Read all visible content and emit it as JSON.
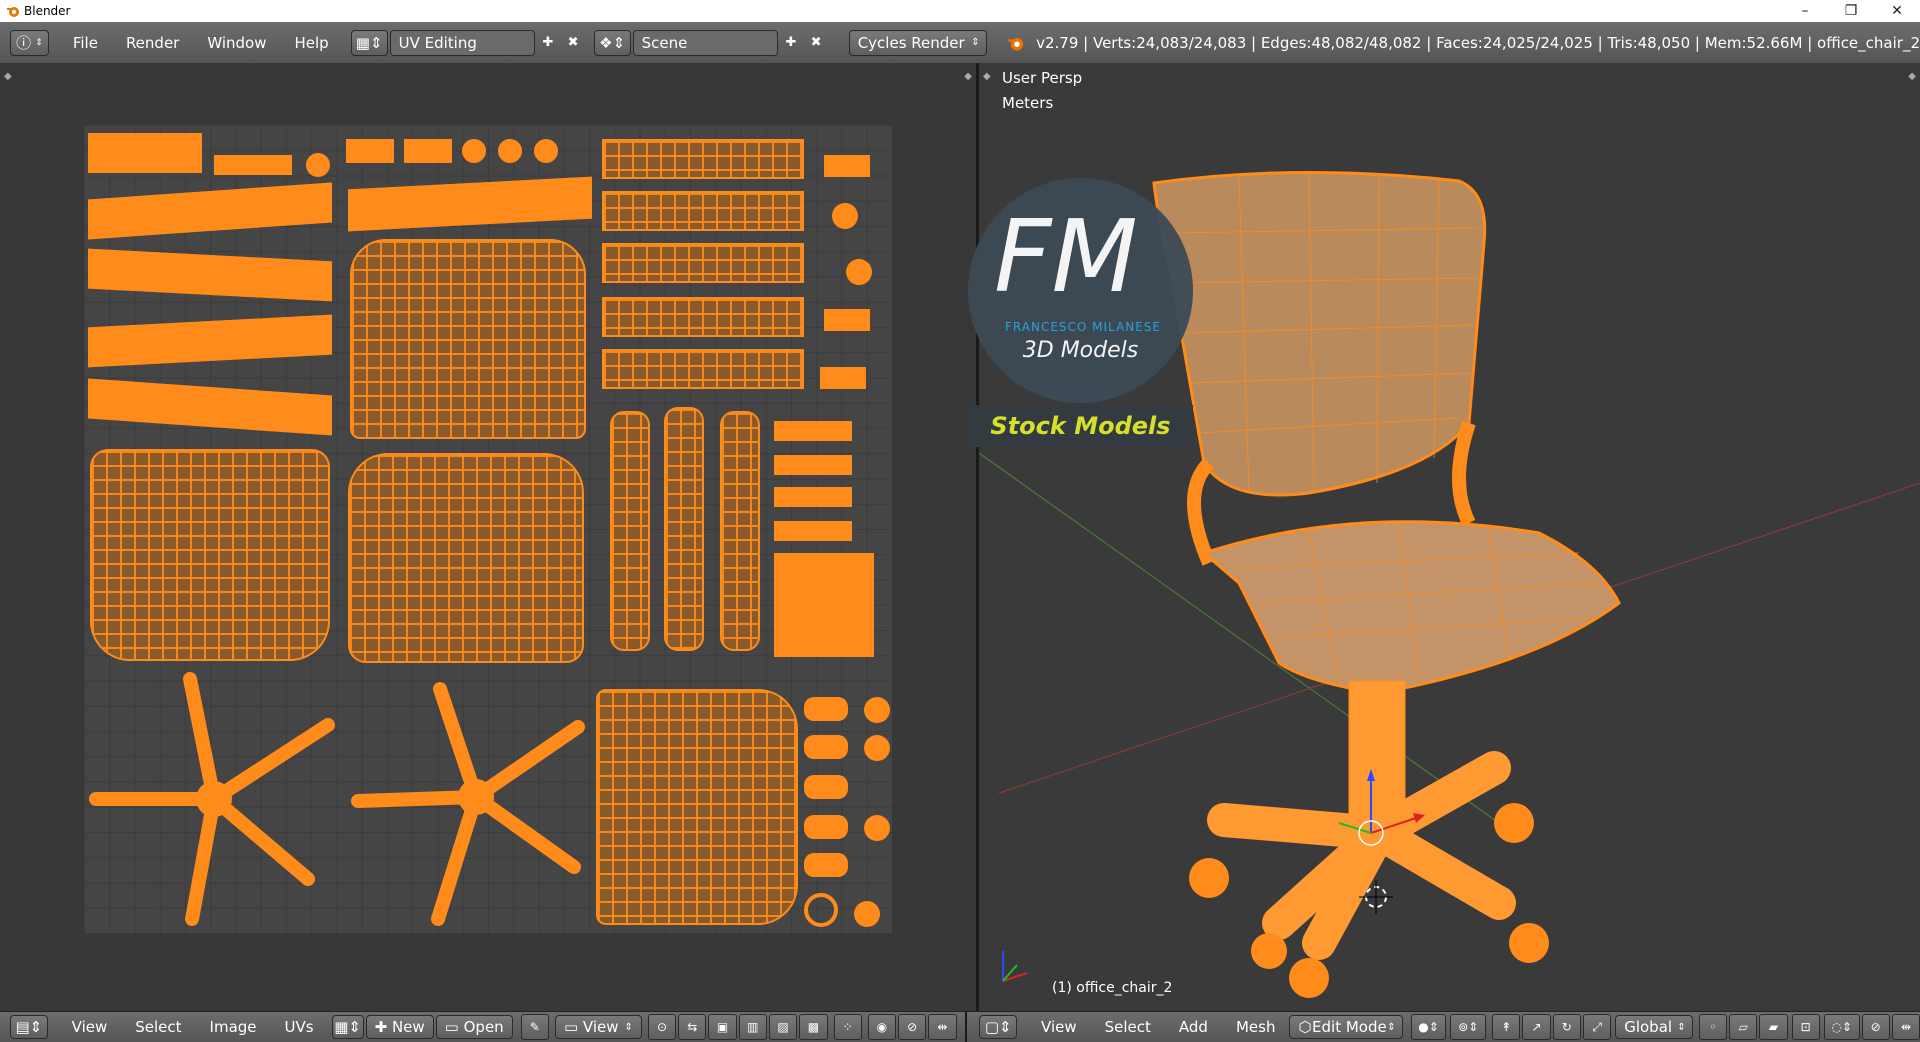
{
  "window": {
    "title": "Blender",
    "controls": [
      "–",
      "❐",
      "✕"
    ]
  },
  "topbar": {
    "menus": [
      "File",
      "Render",
      "Window",
      "Help"
    ],
    "screen_layout": "UV Editing",
    "scene": "Scene",
    "render_engine": "Cycles Render",
    "stats": "v2.79 | Verts:24,083/24,083 | Edges:48,082/48,082 | Faces:24,025/24,025 | Tris:48,050 | Mem:52.66M | office_chair_2"
  },
  "viewport": {
    "view_label": "User Persp",
    "units_label": "Meters",
    "object_label": "(1) office_chair_2",
    "badge": {
      "brand": "FM",
      "author": "FRANCESCO MILANESE",
      "subtitle": "3D Models",
      "banner": "Stock Models"
    }
  },
  "uv_bottombar": {
    "menus": [
      "View",
      "Select",
      "Image",
      "UVs"
    ],
    "new_label": "New",
    "open_label": "Open",
    "view_label": "View"
  },
  "viewport_bottombar": {
    "menus": [
      "View",
      "Select",
      "Add",
      "Mesh"
    ],
    "mode": "Edit Mode",
    "orientation": "Global"
  },
  "colors": {
    "accent": "#ff8c1a",
    "uv_fill": "#8a5a2a",
    "banner_text": "#d6e02a",
    "brand_blue": "#29a8e0"
  }
}
